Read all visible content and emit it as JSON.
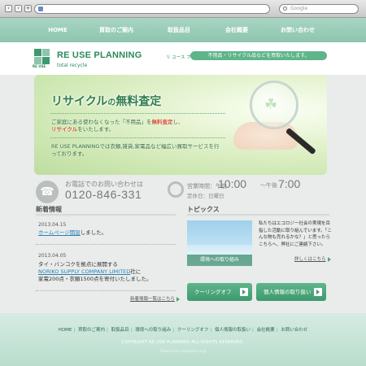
{
  "browser": {
    "search_placeholder": "Google"
  },
  "nav": {
    "items": [
      {
        "label": "HOME"
      },
      {
        "label": "買取のご案内"
      },
      {
        "label": "取扱品目"
      },
      {
        "label": "会社概要"
      },
      {
        "label": "お問い合わせ"
      }
    ]
  },
  "header": {
    "logo_mark": "RE USE",
    "logo_name": "RE USE PLANNING",
    "logo_kana": "リ ユース プランニング",
    "logo_sub": "total recycle",
    "tagline": "不用品・リサイクル品などを買取いたします。"
  },
  "hero": {
    "title_a": "リサイクル",
    "title_b": "の",
    "title_c": "無料査定",
    "p1_a": "ご家庭にある使わなくなった「不用品」を",
    "p1_b": "無料査定",
    "p1_c": "し、",
    "p1_d": "リサイクル",
    "p1_e": "をいたします。",
    "p2": "RE USE PLANNINGでは衣類,雑貨,家電品など幅広い買取サービスを行っております。"
  },
  "contact": {
    "phone_label": "お電話でのお問い合わせは",
    "phone_number": "0120-846-331",
    "hours_label": "営業時間：午前",
    "hours_open": "10:00",
    "hours_sep": "〜午後",
    "hours_close": "7:00",
    "holiday": "定休日：日曜日"
  },
  "news": {
    "title": "新着情報",
    "items": [
      {
        "date": "2013.04.15",
        "link": "ホームページ開設",
        "text": "しました。"
      },
      {
        "date": "2013.04.05",
        "text1": "タイ・バンコクを拠点に展開する",
        "link": "NORIKO SUPPLY COMPANY LIMITED",
        "text2": "社に",
        "text3": "家電200点・衣類1500点を寄付いたしました。"
      }
    ],
    "more": "新着情報一覧はこちら"
  },
  "topics": {
    "title": "トピックス",
    "image_caption": "環境への取り組み",
    "text": "私たちはエコロジー社会の実現を目指した活動に取り組んでいます。「こんな物も売れるかな？」と思ったらこちらへ、弊社にご連絡下さい。",
    "details": "詳しくはこちら",
    "buttons": [
      {
        "label": "クーリングオフ"
      },
      {
        "label": "個人情報の取り扱い"
      }
    ]
  },
  "footer": {
    "links": [
      "HOME",
      "買取のご案内",
      "取扱品目",
      "環境への取り組み",
      "クーリングオフ",
      "個人情報の取扱い",
      "会社概要",
      "お問い合わせ"
    ],
    "copyright": "COPYRIGHT RE USE PLANNING ALL RIGHTS RESERVED.",
    "powered": "Powered by Imagetrue.co.jp"
  },
  "colors": {
    "accent": "#3e9a6e",
    "nav": "#8dc5ae",
    "link": "#2a7fb8",
    "emphasis": "#d6543b"
  }
}
